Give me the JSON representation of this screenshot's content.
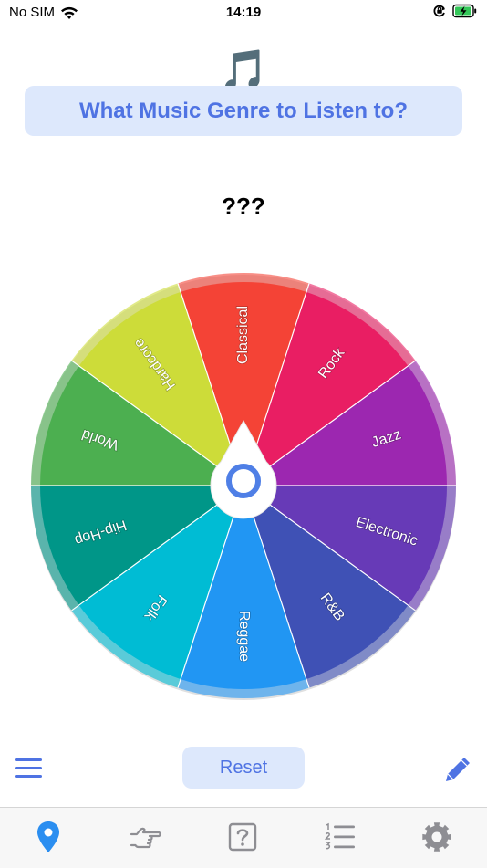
{
  "status_bar": {
    "carrier": "No SIM",
    "time": "14:19"
  },
  "header": {
    "icon": "music-note-icon",
    "icon_glyph": "🎵",
    "title": "What Music Genre to Listen to?"
  },
  "result": {
    "text": "???"
  },
  "wheel": {
    "segments": [
      {
        "label": "Classical",
        "color": "#f44336"
      },
      {
        "label": "Rock",
        "color": "#e91e63"
      },
      {
        "label": "Jazz",
        "color": "#9c27b0"
      },
      {
        "label": "Electronic",
        "color": "#673ab7"
      },
      {
        "label": "R&B",
        "color": "#3f51b5"
      },
      {
        "label": "Reggae",
        "color": "#2196f3"
      },
      {
        "label": "Folk",
        "color": "#00bcd4"
      },
      {
        "label": "Hip-Hop",
        "color": "#009688"
      },
      {
        "label": "World",
        "color": "#4caf50"
      },
      {
        "label": "Hardcore",
        "color": "#cddc39"
      }
    ],
    "pointer_color": "#4f7fe6"
  },
  "toolbar": {
    "reset_label": "Reset",
    "accent": "#4f73e3"
  },
  "tabbar": {
    "items": [
      {
        "name": "location-icon",
        "active": true
      },
      {
        "name": "pointing-hand-icon",
        "active": false
      },
      {
        "name": "question-icon",
        "active": false
      },
      {
        "name": "numbered-list-icon",
        "active": false
      },
      {
        "name": "gear-icon",
        "active": false
      }
    ],
    "active_color": "#2b8ef0",
    "inactive_color": "#8e8e93"
  }
}
